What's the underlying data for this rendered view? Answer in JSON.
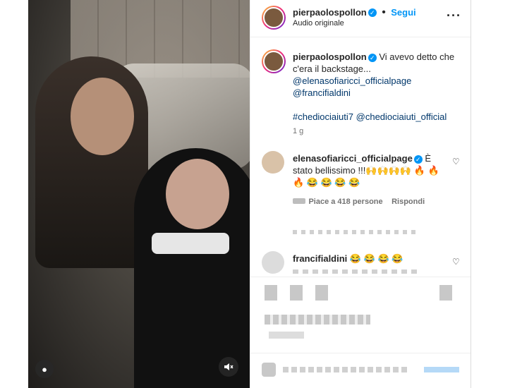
{
  "header": {
    "username": "pierpaolospollon",
    "separator": "•",
    "follow_label": "Segui",
    "audio_label": "Audio originale",
    "more_icon": "more-horizontal-icon"
  },
  "caption": {
    "username": "pierpaolospollon",
    "text": "Vi avevo detto che c'era il backstage...",
    "mention1": "@elenasofiaricci_officialpage",
    "mention2": "@francifialdini",
    "hashtag": "#chediociaiuti7",
    "mention3": "@chediociaiuti_official",
    "age": "1 g"
  },
  "comments": [
    {
      "username": "elenasofiaricci_officialpage",
      "text": "È stato bellissimo !!!🙌🙌🙌🙌 🔥 🔥 🔥 😂 😂 😂 😂",
      "likes": "Piace a 418 persone",
      "reply_label": "Rispondi"
    },
    {
      "username": "francifialdini",
      "text": "😂 😂 😂 😂"
    }
  ],
  "video": {
    "user_icon": "user-icon",
    "mute_icon": "muted-speaker-icon"
  },
  "colors": {
    "follow": "#0095f6",
    "link": "#00376b",
    "verified": "#0095f6"
  }
}
